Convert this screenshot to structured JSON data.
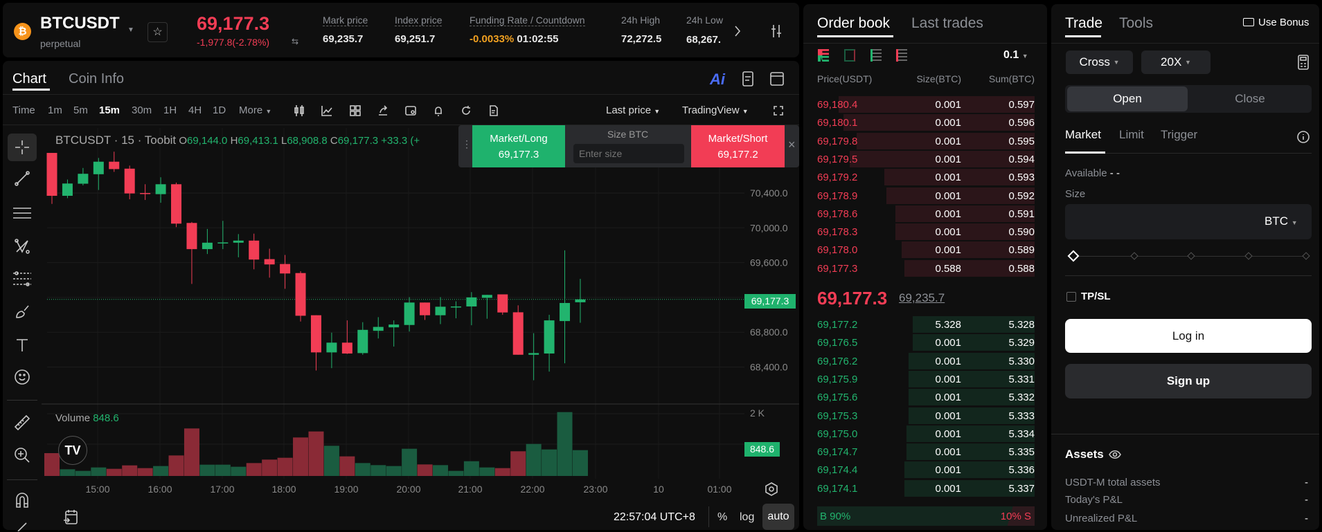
{
  "header": {
    "symbol": "BTCUSDT",
    "contract_type": "perpetual",
    "last_price": "69,177.3",
    "change": "-1,977.8(-2.78%)",
    "stats": [
      {
        "label": "Mark price",
        "value": "69,235.7"
      },
      {
        "label": "Index price",
        "value": "69,251.7"
      },
      {
        "label": "Funding Rate / Countdown",
        "value": "-0.0033%",
        "value2": "01:02:55"
      },
      {
        "label": "24h High",
        "value": "72,272.5"
      },
      {
        "label": "24h Low",
        "value": "68,267."
      }
    ],
    "coin_icon": "₿"
  },
  "chart_tabs": {
    "chart": "Chart",
    "coin_info": "Coin Info",
    "ai": "Ai"
  },
  "toolbar": {
    "intervals": [
      "Time",
      "1m",
      "5m",
      "15m",
      "30m",
      "1H",
      "4H",
      "1D"
    ],
    "active_interval": "15m",
    "more": "More",
    "last_price": "Last price",
    "view": "TradingView"
  },
  "legend": {
    "title": "BTCUSDT · 15 · Toobit",
    "o_label": "O",
    "o": "69,144.0",
    "h_label": "H",
    "h": "69,413.1",
    "l_label": "L",
    "l": "68,908.8",
    "c_label": "C",
    "c": "69,177.3",
    "chg": "+33.3 (+"
  },
  "quick_trade": {
    "long_label": "Market/Long",
    "long_price": "69,177.3",
    "size_label": "Size BTC",
    "size_placeholder": "Enter size",
    "short_label": "Market/Short",
    "short_price": "69,177.2",
    "close": "×"
  },
  "volume": {
    "label": "Volume",
    "value": "848.6",
    "axis": [
      "2 K"
    ],
    "tag": "848.6"
  },
  "footer": {
    "time": "22:57:04 UTC+8",
    "percent": "%",
    "log": "log",
    "auto": "auto"
  },
  "chart_data": {
    "type": "candlestick",
    "symbol": "BTCUSDT",
    "interval": "15",
    "y_ticks": [
      "70,400.0",
      "70,000.0",
      "69,600.0",
      "68,800.0",
      "68,400.0"
    ],
    "y_tick_values": [
      70400,
      70000,
      69600,
      68800,
      68400
    ],
    "current_price": 69177.3,
    "current_price_label": "69,177.3",
    "x_ticks": [
      "15:00",
      "16:00",
      "17:00",
      "18:00",
      "19:00",
      "20:00",
      "21:00",
      "22:00",
      "23:00",
      "10",
      "01:00"
    ],
    "ohlc": [
      [
        70861,
        70368,
        70861,
        70275
      ],
      [
        70368,
        70509,
        70555,
        70341
      ],
      [
        70507,
        70621,
        70688,
        70488
      ],
      [
        70616,
        70760,
        70803,
        70435
      ],
      [
        70760,
        70675,
        70875,
        70643
      ],
      [
        70680,
        70395,
        70715,
        70328
      ],
      [
        70400,
        70395,
        70501,
        70320
      ],
      [
        70387,
        70501,
        70581,
        70288
      ],
      [
        70501,
        70048,
        70520,
        70008
      ],
      [
        70056,
        69755,
        70067,
        69355
      ],
      [
        69755,
        69829,
        69987,
        69699
      ],
      [
        69829,
        69832,
        70080,
        69755
      ],
      [
        69829,
        69853,
        69928,
        69661
      ],
      [
        69853,
        69635,
        69933,
        69523
      ],
      [
        69640,
        69579,
        69760,
        69427
      ],
      [
        69584,
        69475,
        69688,
        69299
      ],
      [
        69480,
        68989,
        69501,
        68923
      ],
      [
        68995,
        68568,
        68995,
        68360
      ],
      [
        68568,
        68680,
        68795,
        68387
      ],
      [
        68680,
        68555,
        68936,
        68550
      ],
      [
        68560,
        68827,
        68915,
        68541
      ],
      [
        68816,
        68861,
        68973,
        68728
      ],
      [
        68856,
        68888,
        68936,
        68635
      ],
      [
        68883,
        69141,
        69203,
        68808
      ],
      [
        69141,
        68995,
        69141,
        68941
      ],
      [
        68995,
        69093,
        69203,
        68893
      ],
      [
        69093,
        69096,
        69155,
        68960
      ],
      [
        69096,
        69200,
        69261,
        68880
      ],
      [
        69195,
        69229,
        69229,
        68955
      ],
      [
        69235,
        69027,
        69235,
        69000
      ],
      [
        69029,
        68541,
        69109,
        68541
      ],
      [
        68541,
        68560,
        68789,
        68248
      ],
      [
        68555,
        68936,
        69000,
        68347
      ],
      [
        68928,
        69136,
        69741,
        68443
      ],
      [
        69144,
        69177.3,
        69413.1,
        68908.8
      ]
    ],
    "volumes": [
      750,
      220,
      167,
      280,
      235,
      348,
      258,
      326,
      674,
      1561,
      371,
      371,
      303,
      424,
      538,
      598,
      1265,
      1462,
      992,
      644,
      424,
      356,
      326,
      894,
      379,
      356,
      167,
      485,
      280,
      258,
      811,
      1053,
      871,
      2098,
      848.6
    ],
    "volume_up": [
      false,
      true,
      true,
      true,
      false,
      false,
      false,
      true,
      false,
      false,
      true,
      true,
      true,
      false,
      false,
      false,
      false,
      false,
      true,
      false,
      true,
      true,
      true,
      true,
      false,
      true,
      true,
      true,
      true,
      false,
      false,
      true,
      true,
      true,
      true
    ],
    "volume_ylim": [
      0,
      2000
    ]
  },
  "orderbook": {
    "tabs": [
      "Order book",
      "Last trades"
    ],
    "precision": "0.1",
    "headers": [
      "Price(USDT)",
      "Size(BTC)",
      "Sum(BTC)"
    ],
    "asks": [
      [
        "69,180.4",
        "0.001",
        "0.597",
        0.9
      ],
      [
        "69,180.1",
        "0.001",
        "0.596",
        0.88
      ],
      [
        "69,179.8",
        "0.001",
        "0.595",
        0.82
      ],
      [
        "69,179.5",
        "0.001",
        "0.594",
        0.85
      ],
      [
        "69,179.2",
        "0.001",
        "0.593",
        0.69
      ],
      [
        "69,178.9",
        "0.001",
        "0.592",
        0.68
      ],
      [
        "69,178.6",
        "0.001",
        "0.591",
        0.64
      ],
      [
        "69,178.3",
        "0.001",
        "0.590",
        0.64
      ],
      [
        "69,178.0",
        "0.001",
        "0.589",
        0.61
      ],
      [
        "69,177.3",
        "0.588",
        "0.588",
        0.6
      ]
    ],
    "mid_price": "69,177.3",
    "mark_price": "69,235.7",
    "bids": [
      [
        "69,177.2",
        "5.328",
        "5.328",
        0.56
      ],
      [
        "69,176.5",
        "0.001",
        "5.329",
        0.56
      ],
      [
        "69,176.2",
        "0.001",
        "5.330",
        0.58
      ],
      [
        "69,175.9",
        "0.001",
        "5.331",
        0.58
      ],
      [
        "69,175.6",
        "0.001",
        "5.332",
        0.58
      ],
      [
        "69,175.3",
        "0.001",
        "5.333",
        0.58
      ],
      [
        "69,175.0",
        "0.001",
        "5.334",
        0.59
      ],
      [
        "69,174.7",
        "0.001",
        "5.335",
        0.59
      ],
      [
        "69,174.4",
        "0.001",
        "5.336",
        0.6
      ],
      [
        "69,174.1",
        "0.001",
        "5.337",
        0.6
      ]
    ],
    "buy_label": "B 90%",
    "sell_label": "10% S",
    "buy_ratio": 0.9
  },
  "trade": {
    "tabs": [
      "Trade",
      "Tools"
    ],
    "use_bonus": "Use Bonus",
    "margin_mode": "Cross",
    "leverage": "20X",
    "open": "Open",
    "close": "Close",
    "order_types": [
      "Market",
      "Limit",
      "Trigger"
    ],
    "available_label": "Available",
    "available_value": "- -",
    "size_label": "Size",
    "size_unit": "BTC",
    "slider_value": 0,
    "tpsl": "TP/SL",
    "login": "Log in",
    "signup": "Sign up",
    "assets_title": "Assets",
    "assets": [
      {
        "label": "USDT-M total assets",
        "value": "-"
      },
      {
        "label": "Today's P&L",
        "value": "-"
      },
      {
        "label": "Unrealized P&L",
        "value": "-"
      }
    ]
  },
  "colors": {
    "up": "#22b46e",
    "down": "#f23d55",
    "vol_up": "#1a5c40",
    "vol_down": "#8a2a36",
    "panel": "#0f0f0f"
  }
}
